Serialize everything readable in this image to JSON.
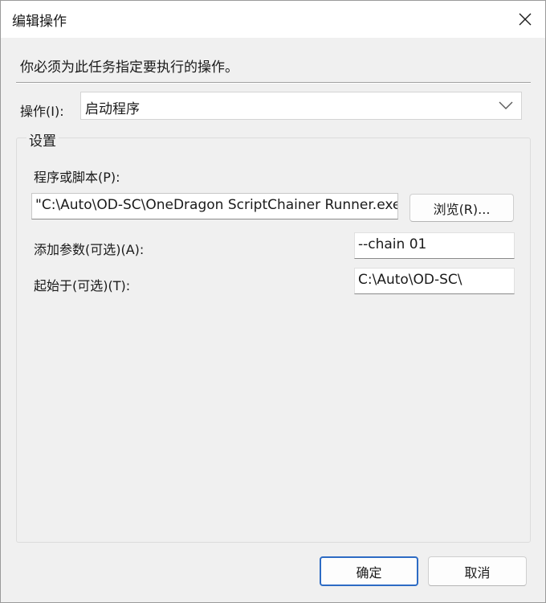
{
  "window": {
    "title": "编辑操作"
  },
  "instruction": "你必须为此任务指定要执行的操作。",
  "action": {
    "label": "操作(I):",
    "selected": "启动程序"
  },
  "settings": {
    "group_title": "设置",
    "program_label": "程序或脚本(P):",
    "program_value": "\"C:\\Auto\\OD-SC\\OneDragon ScriptChainer Runner.exe",
    "browse_label": "浏览(R)...",
    "args_label": "添加参数(可选)(A):",
    "args_value": "--chain 01",
    "start_label": "起始于(可选)(T):",
    "start_value": "C:\\Auto\\OD-SC\\"
  },
  "buttons": {
    "ok": "确定",
    "cancel": "取消"
  },
  "icons": {
    "close": "close-icon",
    "dropdown": "chevron-down-icon"
  }
}
